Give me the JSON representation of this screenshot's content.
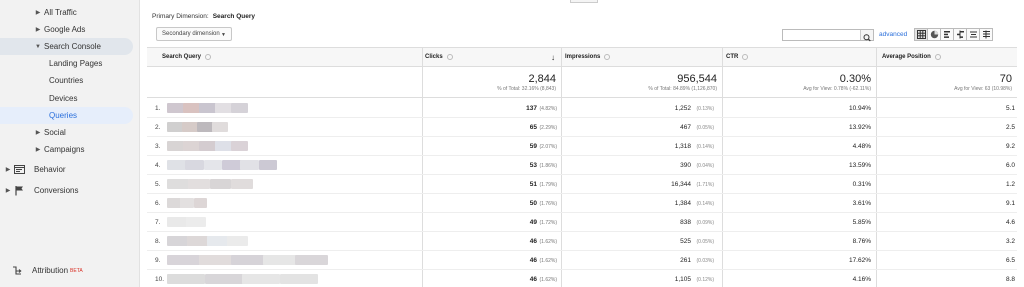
{
  "sidebar": {
    "items": [
      {
        "label": "All Traffic"
      },
      {
        "label": "Google Ads"
      },
      {
        "label": "Search Console"
      },
      {
        "label": "Landing Pages"
      },
      {
        "label": "Countries"
      },
      {
        "label": "Devices"
      },
      {
        "label": "Queries"
      },
      {
        "label": "Social"
      },
      {
        "label": "Campaigns"
      },
      {
        "label": "Behavior"
      },
      {
        "label": "Conversions"
      },
      {
        "label": "Attribution",
        "badge": "BETA"
      }
    ]
  },
  "toolbar": {
    "primary_dimension_label": "Primary Dimension:",
    "primary_dimension_value": "Search Query",
    "secondary_dimension": "Secondary dimension",
    "search_placeholder": "",
    "advanced_label": "advanced"
  },
  "table": {
    "headers": {
      "query": "Search Query",
      "clicks": "Clicks",
      "impressions": "Impressions",
      "ctr": "CTR",
      "position": "Average Position"
    },
    "totals": {
      "clicks": "2,844",
      "clicks_sub": "% of Total: 32.16% (8,843)",
      "impressions": "956,544",
      "impressions_sub": "% of Total: 84.89% (1,126,870)",
      "ctr": "0.30%",
      "ctr_sub": "Avg for View: 0.78% (-62.11%)",
      "position": "70",
      "position_sub": "Avg for View: 63 (10.98%)"
    },
    "rows": [
      {
        "n": "1.",
        "clicks": "137",
        "clicks_pct": "(4.82%)",
        "impr": "1,252",
        "impr_pct": "(0.13%)",
        "ctr": "10.94%",
        "pos": "5.1"
      },
      {
        "n": "2.",
        "clicks": "65",
        "clicks_pct": "(2.29%)",
        "impr": "467",
        "impr_pct": "(0.05%)",
        "ctr": "13.92%",
        "pos": "2.5"
      },
      {
        "n": "3.",
        "clicks": "59",
        "clicks_pct": "(2.07%)",
        "impr": "1,318",
        "impr_pct": "(0.14%)",
        "ctr": "4.48%",
        "pos": "9.2"
      },
      {
        "n": "4.",
        "clicks": "53",
        "clicks_pct": "(1.86%)",
        "impr": "390",
        "impr_pct": "(0.04%)",
        "ctr": "13.59%",
        "pos": "6.0"
      },
      {
        "n": "5.",
        "clicks": "51",
        "clicks_pct": "(1.79%)",
        "impr": "16,344",
        "impr_pct": "(1.71%)",
        "ctr": "0.31%",
        "pos": "1.2"
      },
      {
        "n": "6.",
        "clicks": "50",
        "clicks_pct": "(1.76%)",
        "impr": "1,384",
        "impr_pct": "(0.14%)",
        "ctr": "3.61%",
        "pos": "9.1"
      },
      {
        "n": "7.",
        "clicks": "49",
        "clicks_pct": "(1.72%)",
        "impr": "838",
        "impr_pct": "(0.09%)",
        "ctr": "5.85%",
        "pos": "4.6"
      },
      {
        "n": "8.",
        "clicks": "46",
        "clicks_pct": "(1.62%)",
        "impr": "525",
        "impr_pct": "(0.05%)",
        "ctr": "8.76%",
        "pos": "3.2"
      },
      {
        "n": "9.",
        "clicks": "46",
        "clicks_pct": "(1.62%)",
        "impr": "261",
        "impr_pct": "(0.03%)",
        "ctr": "17.62%",
        "pos": "6.5"
      },
      {
        "n": "10.",
        "clicks": "46",
        "clicks_pct": "(1.62%)",
        "impr": "1,105",
        "impr_pct": "(0.12%)",
        "ctr": "4.16%",
        "pos": "8.8"
      }
    ]
  },
  "colors": {
    "link": "#2a6fdb",
    "sidebar_bg": "#f2f2f2",
    "active_bg": "#e6eefb",
    "beta": "#d93025"
  }
}
